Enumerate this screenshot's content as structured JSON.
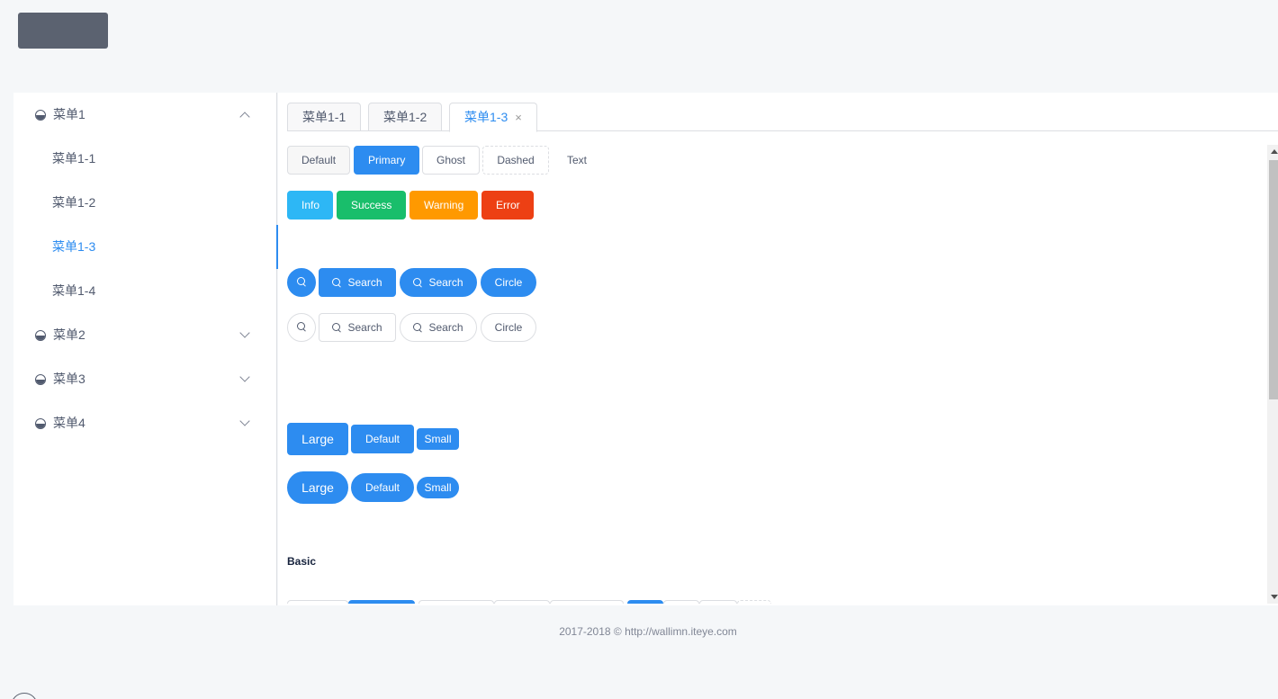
{
  "sidebar": {
    "menus": [
      {
        "label": "菜单1",
        "expanded": true,
        "icon": "ionic-icon"
      },
      {
        "label": "菜单2",
        "expanded": false,
        "icon": "ionic-icon"
      },
      {
        "label": "菜单3",
        "expanded": false,
        "icon": "ionic-icon"
      },
      {
        "label": "菜单4",
        "expanded": false,
        "icon": "ionic-icon"
      }
    ],
    "submenu": [
      "菜单1-1",
      "菜单1-2",
      "菜单1-3",
      "菜单1-4"
    ],
    "active_submenu": "菜单1-3"
  },
  "tabs": [
    {
      "label": "菜单1-1",
      "active": false
    },
    {
      "label": "菜单1-2",
      "active": false
    },
    {
      "label": "菜单1-3",
      "active": true,
      "closable": true
    }
  ],
  "tab_close_glyph": "×",
  "buttons": {
    "types": [
      "Default",
      "Primary",
      "Ghost",
      "Dashed",
      "Text"
    ],
    "colors": [
      "Info",
      "Success",
      "Warning",
      "Error"
    ],
    "search": "Search",
    "circle": "Circle",
    "sizes": [
      "Large",
      "Default",
      "Small"
    ]
  },
  "section_basic": "Basic",
  "footer": "2017-2018 © http://wallimn.iteye.com",
  "theme": {
    "primary": "#2d8cf0",
    "info": "#2db7f5",
    "success": "#19be6b",
    "warning": "#ff9900",
    "error": "#ed4014"
  }
}
